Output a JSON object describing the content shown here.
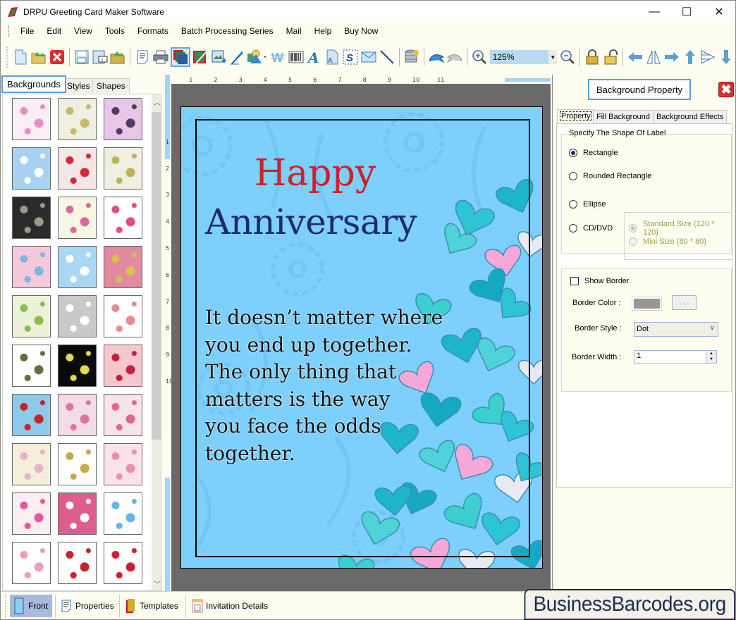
{
  "window": {
    "title": "DRPU Greeting Card Maker Software",
    "minimize": "—",
    "maximize": "☐",
    "close": "✕"
  },
  "menu": [
    "File",
    "Edit",
    "View",
    "Tools",
    "Formats",
    "Batch Processing Series",
    "Mail",
    "Help",
    "Buy Now"
  ],
  "toolbar": {
    "zoom_value": "125%",
    "icons": [
      "new-icon",
      "open-icon",
      "close-file-icon",
      "save-icon",
      "save-as-icon",
      "open-folder-icon",
      "properties-icon",
      "print-icon",
      "background-icon",
      "image-edit-icon",
      "insert-image-icon",
      "pen-icon",
      "shapes-icon",
      "watermark-icon",
      "barcode-icon",
      "text-icon",
      "text-file-icon",
      "signature-icon",
      "mail-icon",
      "line-icon",
      "database-icon",
      "undo-icon",
      "redo-icon",
      "zoom-in-icon",
      "zoom-out-icon",
      "lock-icon",
      "unlock-icon",
      "arrow-left-icon",
      "flip-horizontal-icon",
      "arrow-right-icon",
      "arrow-up-icon",
      "align-icon",
      "arrow-down-icon"
    ]
  },
  "left_panel": {
    "tabs": [
      "Backgrounds",
      "Styles",
      "Shapes"
    ],
    "selected_tab": "Backgrounds",
    "thumbnails": [
      {
        "name": "baby-items",
        "bg": "#fbeff6",
        "fg": "#e78ec0"
      },
      {
        "name": "bunnies-cream",
        "bg": "#eff0e2",
        "fg": "#c9b86a"
      },
      {
        "name": "purple-flowers",
        "bg": "#e7c6e8",
        "fg": "#4d3d5e"
      },
      {
        "name": "clouds",
        "bg": "#a9d2f2",
        "fg": "#ffffff"
      },
      {
        "name": "strawberries",
        "bg": "#f6e7e7",
        "fg": "#d32a36"
      },
      {
        "name": "green-yellow-fruits",
        "bg": "#f1efe2",
        "fg": "#b9b65a"
      },
      {
        "name": "dark-leaves",
        "bg": "#2a2a2a",
        "fg": "#9a9a8a"
      },
      {
        "name": "flower-garland",
        "bg": "#f7f5e4",
        "fg": "#d86aa0"
      },
      {
        "name": "gift-boxes",
        "bg": "#ffffff",
        "fg": "#e54e75"
      },
      {
        "name": "pastel-circles",
        "bg": "#f5c8db",
        "fg": "#7ab8e0"
      },
      {
        "name": "snowflakes-blue",
        "bg": "#a9d8f3",
        "fg": "#ffffff"
      },
      {
        "name": "colored-buttons",
        "bg": "#e28aa2",
        "fg": "#d5c34c"
      },
      {
        "name": "christmas-trees",
        "bg": "#ebf2d7",
        "fg": "#8bbb52"
      },
      {
        "name": "white-heart",
        "bg": "#c9c9c9",
        "fg": "#ffffff"
      },
      {
        "name": "kids-doodles",
        "bg": "#ffffff",
        "fg": "#e78c8c"
      },
      {
        "name": "pinecones",
        "bg": "#ffffff",
        "fg": "#6b6b3a"
      },
      {
        "name": "fireworks",
        "bg": "#0a0a0a",
        "fg": "#e6d94a"
      },
      {
        "name": "red-hearts",
        "bg": "#f6c6cf",
        "fg": "#c81f3c"
      },
      {
        "name": "santa-gifts",
        "bg": "#8ecae8",
        "fg": "#c8202c"
      },
      {
        "name": "pink-bubbles",
        "bg": "#f3dce6",
        "fg": "#e073a3"
      },
      {
        "name": "pink-lilies",
        "bg": "#f7e4ea",
        "fg": "#e2649a"
      },
      {
        "name": "pastel-stripes",
        "bg": "#f6eedc",
        "fg": "#e9b1c8"
      },
      {
        "name": "teddy-bear",
        "bg": "#ffffff",
        "fg": "#caa84a"
      },
      {
        "name": "pink-dress",
        "bg": "#fbe3ea",
        "fg": "#ea8fae"
      },
      {
        "name": "hearts-flowers",
        "bg": "#fbeef0",
        "fg": "#e6589b"
      },
      {
        "name": "heart-frame",
        "bg": "#dc5d8e",
        "fg": "#ffffff"
      },
      {
        "name": "easter-bunnies",
        "bg": "#ffffff",
        "fg": "#64b4e6"
      },
      {
        "name": "kids-rainbow",
        "bg": "#ffffff",
        "fg": "#f09ac0"
      },
      {
        "name": "ribbon-hearts",
        "bg": "#ffffff",
        "fg": "#c8202c"
      },
      {
        "name": "red-flower",
        "bg": "#ffffff",
        "fg": "#cf1f2a"
      }
    ]
  },
  "rulers": {
    "horizontal": [
      "1",
      "2",
      "3",
      "4",
      "5",
      "6",
      "7",
      "8",
      "9",
      "10",
      "11"
    ],
    "vertical": [
      "1",
      "2",
      "3",
      "4",
      "5",
      "6",
      "7",
      "8",
      "9",
      "10"
    ]
  },
  "card": {
    "title_line1": "Happy",
    "title_line2": "Anniversary",
    "verse": [
      "It doesn’t matter where",
      "you end up together.",
      "The only thing that",
      "matters is the way",
      "you face the odds",
      "together."
    ],
    "colors": {
      "background": "#7dd0fc",
      "title1": "#cf2128",
      "title2": "#1f2a66",
      "verse": "#111111"
    }
  },
  "right_panel": {
    "title": "Background Property",
    "tabs": [
      "Property",
      "Fill Background",
      "Background Effects"
    ],
    "selected_tab": "Property",
    "shape_group_label": "Specify The Shape Of Label",
    "shapes": [
      {
        "label": "Rectangle",
        "selected": true
      },
      {
        "label": "Rounded Rectangle",
        "selected": false
      },
      {
        "label": "Ellipse",
        "selected": false
      },
      {
        "label": "CD/DVD",
        "selected": false
      }
    ],
    "sizes": [
      {
        "label": "Standard Size (120 * 120)",
        "selected": true,
        "disabled": true
      },
      {
        "label": "Mini Size (80 * 80)",
        "selected": false,
        "disabled": true
      }
    ],
    "show_border_label": "Show Border",
    "show_border_checked": false,
    "border_color_label": "Border Color :",
    "border_color": "#9a9696",
    "border_color_button": ". . .",
    "border_style_label": "Border Style :",
    "border_style_value": "Dot",
    "border_width_label": "Border Width :",
    "border_width_value": "1"
  },
  "bottom_tabs": [
    {
      "label": "Front",
      "selected": true
    },
    {
      "label": "Properties",
      "selected": false
    },
    {
      "label": "Templates",
      "selected": false
    },
    {
      "label": "Invitation Details",
      "selected": false
    }
  ],
  "watermark": "BusinessBarcodes.org"
}
